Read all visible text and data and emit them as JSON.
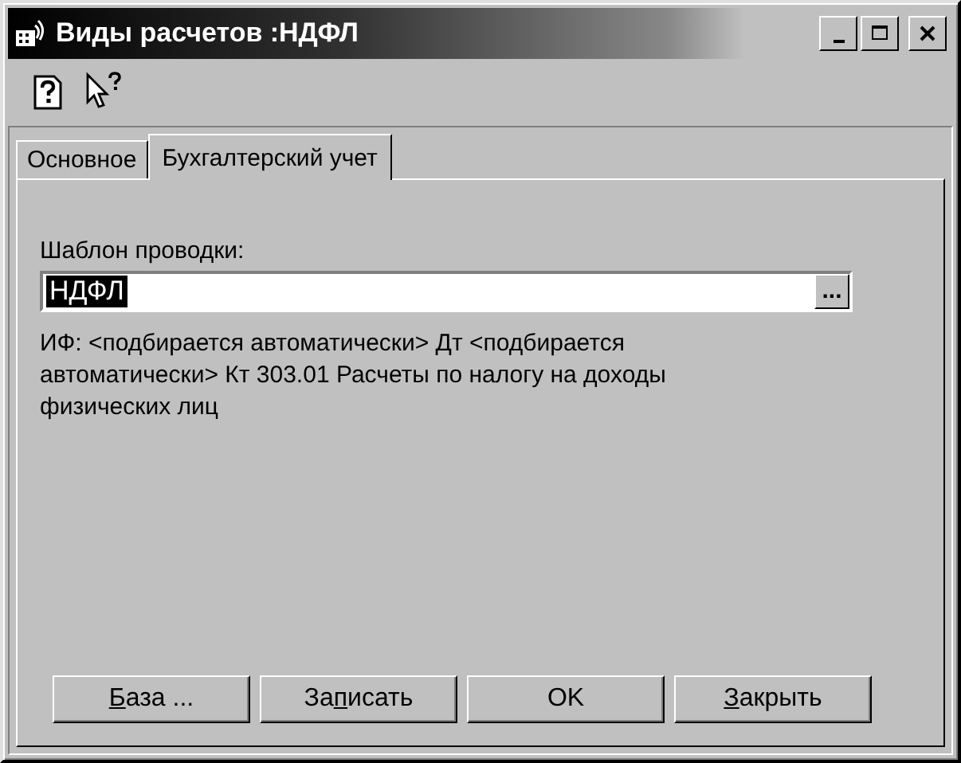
{
  "window": {
    "title": "Виды расчетов :НДФЛ"
  },
  "tabs": [
    {
      "label": "Основное",
      "selected": false
    },
    {
      "label": "Бухгалтерский учет",
      "selected": true
    }
  ],
  "template_field": {
    "label": "Шаблон проводки:",
    "value": "НДФЛ",
    "value_selected": true,
    "browse": "..."
  },
  "description": "ИФ: <подбирается автоматически> Дт <подбирается автоматически> Кт  303.01 Расчеты по налогу на доходы физических лиц",
  "buttons": [
    {
      "hotkey": "Б",
      "after": "аза ..."
    },
    {
      "before": "За",
      "hotkey": "п",
      "after": "исать"
    },
    {
      "before": "OK"
    },
    {
      "hotkey": "З",
      "after": "акрыть"
    }
  ]
}
